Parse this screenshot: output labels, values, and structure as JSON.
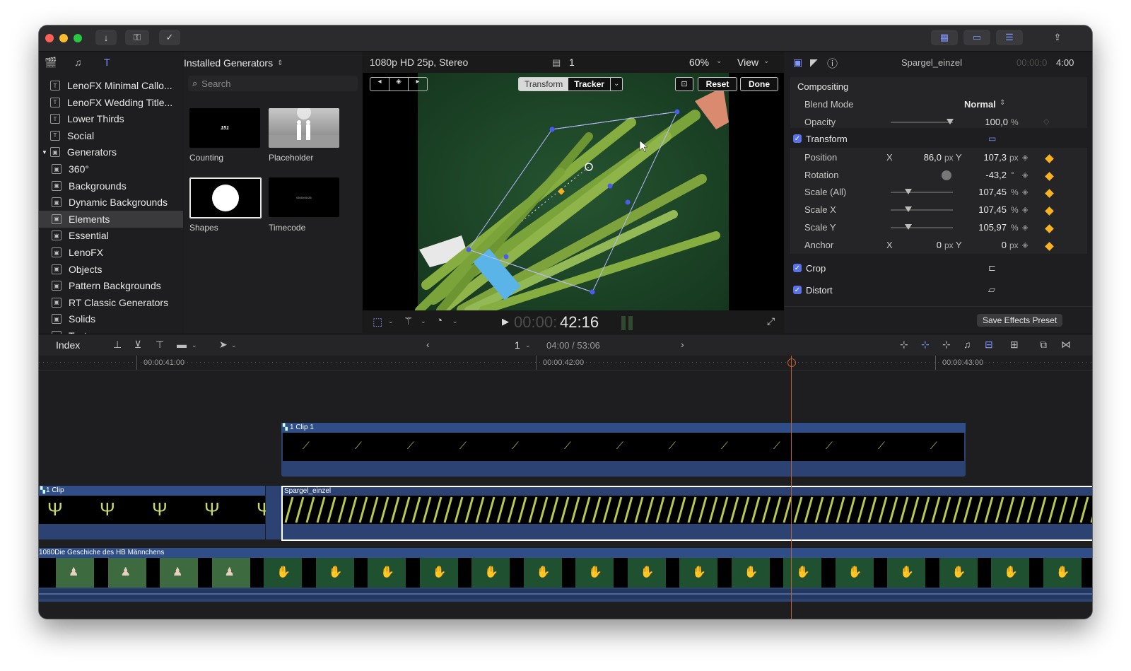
{
  "titlebar": {
    "import_icon": "download-arrow-icon",
    "keyword_icon": "key-icon",
    "check_icon": "checkmark-circle-icon"
  },
  "browser": {
    "sidebar_items": [
      {
        "label": "LenoFX Minimal Callo...",
        "type": "title"
      },
      {
        "label": "LenoFX Wedding Title...",
        "type": "title"
      },
      {
        "label": "Lower Thirds",
        "type": "title"
      },
      {
        "label": "Social",
        "type": "title"
      },
      {
        "label": "Generators",
        "type": "group"
      },
      {
        "label": "360°",
        "type": "gen"
      },
      {
        "label": "Backgrounds",
        "type": "gen"
      },
      {
        "label": "Dynamic Backgrounds",
        "type": "gen"
      },
      {
        "label": "Elements",
        "type": "gen",
        "selected": true
      },
      {
        "label": "Essential",
        "type": "gen"
      },
      {
        "label": "LenoFX",
        "type": "gen"
      },
      {
        "label": "Objects",
        "type": "gen"
      },
      {
        "label": "Pattern Backgrounds",
        "type": "gen"
      },
      {
        "label": "RT Classic Generators",
        "type": "gen"
      },
      {
        "label": "Solids",
        "type": "gen"
      },
      {
        "label": "Textures",
        "type": "gen"
      }
    ],
    "header_title": "Installed Generators",
    "search_placeholder": "Search",
    "items": [
      {
        "label": "Counting",
        "overlay": "151"
      },
      {
        "label": "Placeholder"
      },
      {
        "label": "Shapes"
      },
      {
        "label": "Timecode",
        "overlay": "00:00:00:25"
      }
    ]
  },
  "viewer": {
    "format": "1080p HD 25p, Stereo",
    "clip_count": "1",
    "zoom": "60%",
    "view_label": "View",
    "mode_transform": "Transform",
    "mode_tracker": "Tracker",
    "reset_label": "Reset",
    "done_label": "Done",
    "timecode_dim": "00:00:",
    "timecode_bright": "42:16"
  },
  "inspector": {
    "clip_name": "Spargel_einzel",
    "duration_dim": "00:00:0",
    "duration_bright": "4:00",
    "compositing_title": "Compositing",
    "blend_mode_label": "Blend Mode",
    "blend_mode_value": "Normal",
    "opacity_label": "Opacity",
    "opacity_value": "100,0",
    "percent": "%",
    "transform_title": "Transform",
    "position_label": "Position",
    "x_label": "X",
    "y_label": "Y",
    "position_x": "86,0",
    "position_y": "107,3",
    "px": "px",
    "rotation_label": "Rotation",
    "rotation_value": "-43,2",
    "degree": "°",
    "scale_all_label": "Scale (All)",
    "scale_all_value": "107,45",
    "scale_x_label": "Scale X",
    "scale_x_value": "107,45",
    "scale_y_label": "Scale Y",
    "scale_y_value": "105,97",
    "anchor_label": "Anchor",
    "anchor_x": "0",
    "anchor_y": "0",
    "crop_title": "Crop",
    "distort_title": "Distort",
    "save_preset": "Save Effects Preset"
  },
  "timeline": {
    "index_label": "Index",
    "page": "1",
    "position": "04:00 / 53:06",
    "ruler_labels": [
      "00:00:41:00",
      "00:00:42:00",
      "00:00:43:00"
    ],
    "compound_clip_label": "1 Clip 1",
    "left_clip_label": "1 Clip",
    "selected_clip_label": "Spargel_einzel",
    "primary_clip_label": "1080Die Geschiche des HB Männchens"
  },
  "colors": {
    "accent": "#5a72e8",
    "keyframe": "#f7b21f",
    "clip_blue": "#2c4272",
    "clip_header": "#2f4d86",
    "playhead": "#c0602a"
  }
}
